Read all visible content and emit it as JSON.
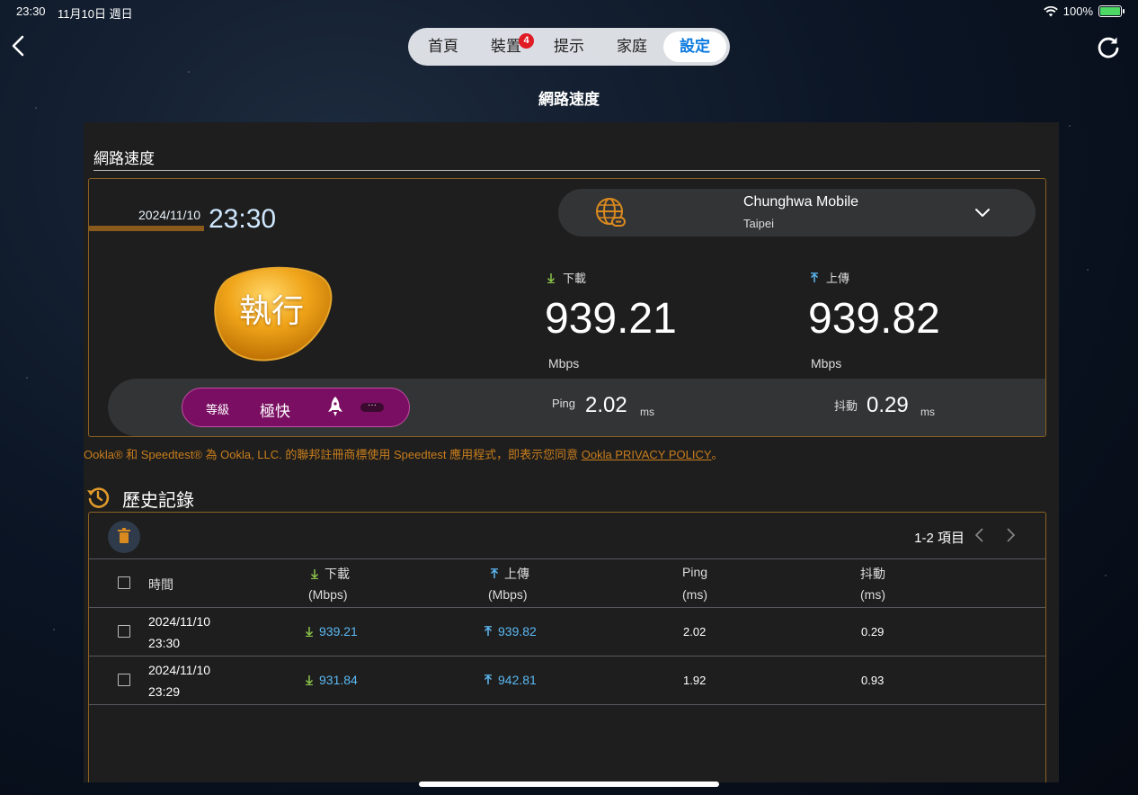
{
  "status_bar": {
    "time": "23:30",
    "date": "11月10日 週日",
    "battery": "100%"
  },
  "nav": {
    "tabs": [
      {
        "label": "首頁"
      },
      {
        "label": "裝置",
        "badge": "4"
      },
      {
        "label": "提示"
      },
      {
        "label": "家庭"
      },
      {
        "label": "設定",
        "active": true
      }
    ],
    "page_title": "網路速度"
  },
  "speedtest": {
    "section_title": "網路速度",
    "date": "2024/11/10",
    "time": "23:30",
    "server_name": "Chunghwa Mobile",
    "server_location": "Taipei",
    "run_label": "執行",
    "download_label": "下載",
    "download_value": "939.21",
    "download_unit": "Mbps",
    "upload_label": "上傳",
    "upload_value": "939.82",
    "upload_unit": "Mbps",
    "level_key": "等級",
    "level_value": "極快",
    "more_label": "···",
    "ping_label": "Ping",
    "ping_value": "2.02",
    "ping_unit": "ms",
    "jitter_label": "抖動",
    "jitter_value": "0.29",
    "jitter_unit": "ms",
    "ookla_text": "Ookla® 和 Speedtest® 為 Ookla, LLC. 的聯邦註冊商標使用 Speedtest 應用程式，即表示您同意",
    "ookla_link": "Ookla PRIVACY POLICY",
    "ookla_tail": "。"
  },
  "history": {
    "title": "歷史記錄",
    "paging": "1-2 項目",
    "columns": {
      "time": "時間",
      "download": "下載",
      "download_unit": "(Mbps)",
      "upload": "上傳",
      "upload_unit": "(Mbps)",
      "ping": "Ping",
      "ping_unit": "(ms)",
      "jitter": "抖動",
      "jitter_unit": "(ms)"
    },
    "rows": [
      {
        "date": "2024/11/10",
        "time": "23:30",
        "download": "939.21",
        "upload": "939.82",
        "ping": "2.02",
        "jitter": "0.29"
      },
      {
        "date": "2024/11/10",
        "time": "23:29",
        "download": "931.84",
        "upload": "942.81",
        "ping": "1.92",
        "jitter": "0.93"
      }
    ]
  },
  "colors": {
    "accent": "#0a7adf",
    "gold": "#c87d1c",
    "link_blue": "#5bb8f2",
    "level_purple": "#7a0e62"
  }
}
